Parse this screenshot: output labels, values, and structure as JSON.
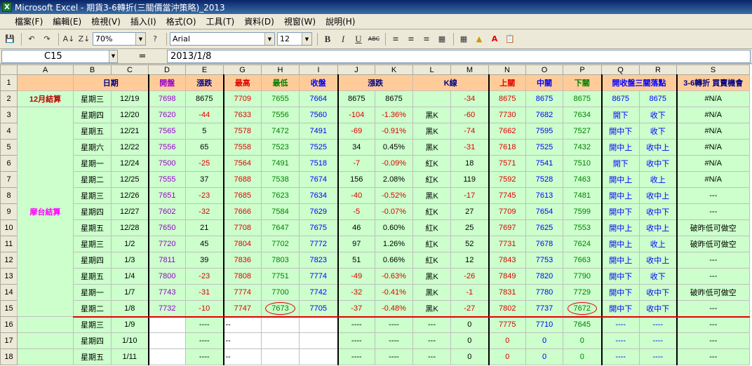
{
  "window": {
    "title": "Microsoft Excel - 期貨3-6轉折(三關價當沖策略)_2013"
  },
  "menu": [
    "檔案(F)",
    "編輯(E)",
    "檢視(V)",
    "插入(I)",
    "格式(O)",
    "工具(T)",
    "資料(D)",
    "視窗(W)",
    "說明(H)"
  ],
  "toolbar": {
    "zoom": "70%",
    "font": "Arial",
    "size": "12",
    "bold": "B",
    "italic": "I",
    "underline": "U",
    "strike": "ABC"
  },
  "formula": {
    "cell": "C15",
    "fx": "=",
    "value": "2013/1/8"
  },
  "columns": [
    "A",
    "B",
    "C",
    "D",
    "E",
    "G",
    "H",
    "I",
    "J",
    "K",
    "L",
    "M",
    "N",
    "O",
    "P",
    "Q",
    "R",
    "S"
  ],
  "header": {
    "date": "日期",
    "open": "開盤",
    "chg": "漲跌",
    "high": "最高",
    "low": "最低",
    "close": "收盤",
    "chg2": "漲跌",
    "kline": "K線",
    "up": "上關",
    "mid": "中關",
    "down": "下關",
    "pos": "開收盤三關落點",
    "turn": "3-6轉折 買賣機會"
  },
  "labels": {
    "dec": "12月結算",
    "tw": "摩台結算"
  },
  "rows": [
    {
      "n": "2",
      "wd": "星期三",
      "d": "12/19",
      "o": "7698",
      "e": "8675",
      "h": "7709",
      "l": "7655",
      "c": "7664",
      "j": "8675",
      "k": "8675",
      "kl": "",
      "m": "-34",
      "u": "8675",
      "mi": "8675",
      "dn": "8675",
      "q": "8675",
      "r": "8675",
      "s": "#N/A"
    },
    {
      "n": "3",
      "wd": "星期四",
      "d": "12/20",
      "o": "7620",
      "e": "-44",
      "h": "7633",
      "l": "7556",
      "c": "7560",
      "j": "-104",
      "k": "-1.36%",
      "kl": "黑K",
      "m": "-60",
      "u": "7730",
      "mi": "7682",
      "dn": "7634",
      "q": "開下",
      "r": "收下",
      "s": "#N/A"
    },
    {
      "n": "4",
      "wd": "星期五",
      "d": "12/21",
      "o": "7565",
      "e": "5",
      "h": "7578",
      "l": "7472",
      "c": "7491",
      "j": "-69",
      "k": "-0.91%",
      "kl": "黑K",
      "m": "-74",
      "u": "7662",
      "mi": "7595",
      "dn": "7527",
      "q": "開中下",
      "r": "收下",
      "s": "#N/A"
    },
    {
      "n": "5",
      "wd": "星期六",
      "d": "12/22",
      "o": "7556",
      "e": "65",
      "h": "7558",
      "l": "7523",
      "c": "7525",
      "j": "34",
      "k": "0.45%",
      "kl": "黑K",
      "m": "-31",
      "u": "7618",
      "mi": "7525",
      "dn": "7432",
      "q": "開中上",
      "r": "收中上",
      "s": "#N/A"
    },
    {
      "n": "6",
      "wd": "星期一",
      "d": "12/24",
      "o": "7500",
      "e": "-25",
      "h": "7564",
      "l": "7491",
      "c": "7518",
      "j": "-7",
      "k": "-0.09%",
      "kl": "紅K",
      "m": "18",
      "u": "7571",
      "mi": "7541",
      "dn": "7510",
      "q": "開下",
      "r": "收中下",
      "s": "#N/A"
    },
    {
      "n": "7",
      "wd": "星期二",
      "d": "12/25",
      "o": "7555",
      "e": "37",
      "h": "7688",
      "l": "7538",
      "c": "7674",
      "j": "156",
      "k": "2.08%",
      "kl": "紅K",
      "m": "119",
      "u": "7592",
      "mi": "7528",
      "dn": "7463",
      "q": "開中上",
      "r": "收上",
      "s": "#N/A"
    },
    {
      "n": "8",
      "wd": "星期三",
      "d": "12/26",
      "o": "7651",
      "e": "-23",
      "h": "7685",
      "l": "7623",
      "c": "7634",
      "j": "-40",
      "k": "-0.52%",
      "kl": "黑K",
      "m": "-17",
      "u": "7745",
      "mi": "7613",
      "dn": "7481",
      "q": "開中上",
      "r": "收中上",
      "s": "---"
    },
    {
      "n": "9",
      "wd": "星期四",
      "d": "12/27",
      "o": "7602",
      "e": "-32",
      "h": "7666",
      "l": "7584",
      "c": "7629",
      "j": "-5",
      "k": "-0.07%",
      "kl": "紅K",
      "m": "27",
      "u": "7709",
      "mi": "7654",
      "dn": "7599",
      "q": "開中下",
      "r": "收中下",
      "s": "---"
    },
    {
      "n": "10",
      "wd": "星期五",
      "d": "12/28",
      "o": "7650",
      "e": "21",
      "h": "7708",
      "l": "7647",
      "c": "7675",
      "j": "46",
      "k": "0.60%",
      "kl": "紅K",
      "m": "25",
      "u": "7697",
      "mi": "7625",
      "dn": "7553",
      "q": "開中上",
      "r": "收中上",
      "s": "破昨低可做空"
    },
    {
      "n": "11",
      "wd": "星期三",
      "d": "1/2",
      "o": "7720",
      "e": "45",
      "h": "7804",
      "l": "7702",
      "c": "7772",
      "j": "97",
      "k": "1.26%",
      "kl": "紅K",
      "m": "52",
      "u": "7731",
      "mi": "7678",
      "dn": "7624",
      "q": "開中上",
      "r": "收上",
      "s": "破昨低可做空"
    },
    {
      "n": "12",
      "wd": "星期四",
      "d": "1/3",
      "o": "7811",
      "e": "39",
      "h": "7836",
      "l": "7803",
      "c": "7823",
      "j": "51",
      "k": "0.66%",
      "kl": "紅K",
      "m": "12",
      "u": "7843",
      "mi": "7753",
      "dn": "7663",
      "q": "開中上",
      "r": "收中上",
      "s": "---"
    },
    {
      "n": "13",
      "wd": "星期五",
      "d": "1/4",
      "o": "7800",
      "e": "-23",
      "h": "7808",
      "l": "7751",
      "c": "7774",
      "j": "-49",
      "k": "-0.63%",
      "kl": "黑K",
      "m": "-26",
      "u": "7849",
      "mi": "7820",
      "dn": "7790",
      "q": "開中下",
      "r": "收下",
      "s": "---"
    },
    {
      "n": "14",
      "wd": "星期一",
      "d": "1/7",
      "o": "7743",
      "e": "-31",
      "h": "7774",
      "l": "7700",
      "c": "7742",
      "j": "-32",
      "k": "-0.41%",
      "kl": "黑K",
      "m": "-1",
      "u": "7831",
      "mi": "7780",
      "dn": "7729",
      "q": "開中下",
      "r": "收中下",
      "s": "破昨低可做空"
    },
    {
      "n": "15",
      "wd": "星期二",
      "d": "1/8",
      "o": "7732",
      "e": "-10",
      "h": "7747",
      "l": "7673",
      "c": "7705",
      "j": "-37",
      "k": "-0.48%",
      "kl": "黑K",
      "m": "-27",
      "u": "7802",
      "mi": "7737",
      "dn": "7672",
      "q": "開中下",
      "r": "收中下",
      "s": "---"
    }
  ],
  "future": [
    {
      "n": "16",
      "wd": "星期三",
      "d": "1/9",
      "e": "----",
      "h": "--",
      "j": "----",
      "k": "----",
      "kl": "---",
      "m": "0",
      "u": "7775",
      "mi": "7710",
      "dn": "7645",
      "q": "----",
      "r": "----",
      "s": "---"
    },
    {
      "n": "17",
      "wd": "星期四",
      "d": "1/10",
      "e": "----",
      "h": "--",
      "j": "----",
      "k": "----",
      "kl": "---",
      "m": "0",
      "u": "0",
      "mi": "0",
      "dn": "0",
      "q": "----",
      "r": "----",
      "s": "---"
    },
    {
      "n": "18",
      "wd": "星期五",
      "d": "1/11",
      "e": "----",
      "h": "--",
      "j": "----",
      "k": "----",
      "kl": "---",
      "m": "0",
      "u": "0",
      "mi": "0",
      "dn": "0",
      "q": "----",
      "r": "----",
      "s": "---"
    }
  ]
}
